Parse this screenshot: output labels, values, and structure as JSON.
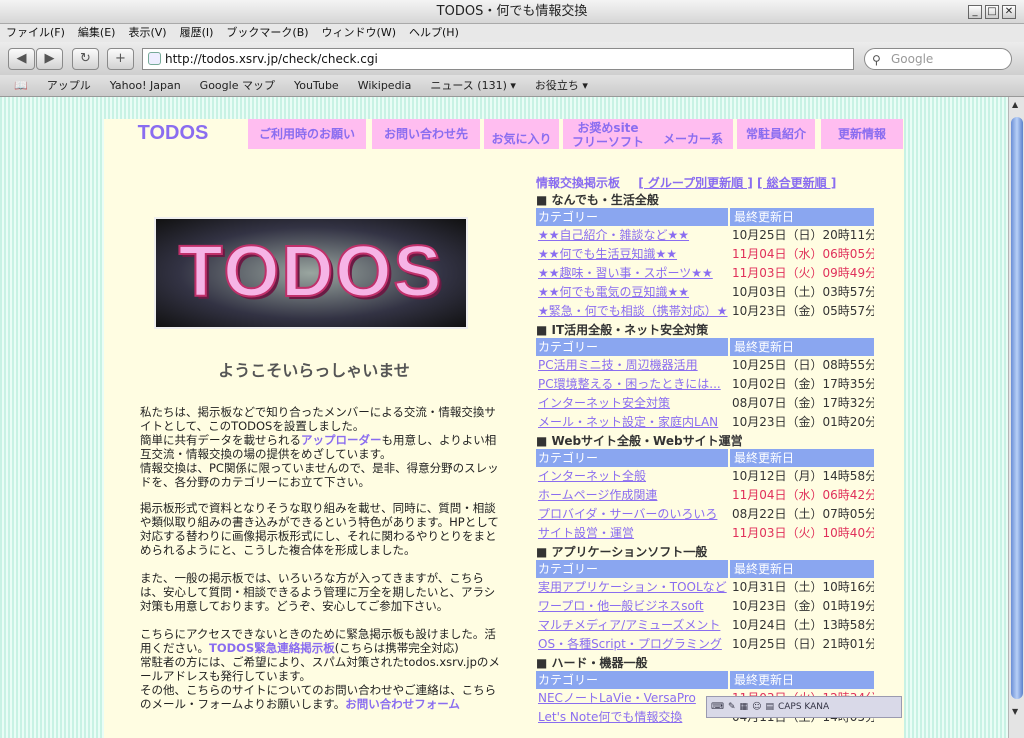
{
  "window": {
    "title": "TODOS・何でも情報交換"
  },
  "menu": [
    "ファイル(F)",
    "編集(E)",
    "表示(V)",
    "履歴(I)",
    "ブックマーク(B)",
    "ウィンドウ(W)",
    "ヘルプ(H)"
  ],
  "toolbar": {
    "url": "http://todos.xsrv.jp/check/check.cgi",
    "search_placeholder": "Google"
  },
  "bookmarks": [
    "アップル",
    "Yahoo! Japan",
    "Google マップ",
    "YouTube",
    "Wikipedia",
    "ニュース (131) ▾",
    "お役立ち ▾"
  ],
  "nav": {
    "logo": "TODOS",
    "tabs": [
      "ご利用時のお願い",
      "お問い合わせ先",
      "お気に入り",
      "お奨めsite",
      "フリーソフト",
      "メーカー系",
      "常駐員紹介",
      "更新情報"
    ]
  },
  "banner_text": "TODOS",
  "welcome": "ようこそいらっしゃいませ",
  "intro": {
    "p1a": "私たちは、掲示板などで知り合ったメンバーによる交流・情報交換サイトとして、このTODOSを設置しました。",
    "p1b": "簡単に共有データを載せられる",
    "p1link": "アップローダー",
    "p1c": "も用意し、よりよい相互交流・情報交換の場の提供をめざしています。",
    "p1d": "情報交換は、PC関係に限っていませんので、是非、得意分野のスレッドを、各分野のカテゴリーにお立て下さい。",
    "p2": "掲示板形式で資料となりそうな取り組みを載せ、同時に、質問・相談や類似取り組みの書き込みができるという特色があります。HPとして対応する替わりに画像掲示板形式にし、それに関わるやりとりをまとめられるようにと、こうした複合体を形成しました。",
    "p3": "また、一般の掲示板では、いろいろな方が入ってきますが、こちらは、安心して質問・相談できるよう管理に万全を期したいと、アラシ対策も用意しております。どうぞ、安心してご参加下さい。",
    "p4a": "こちらにアクセスできないときのために緊急掲示板も設けました。活用ください。",
    "p4link": "TODOS緊急連絡掲示板",
    "p4b": "(こちらは携帯完全対応)",
    "p4c": "常駐者の方には、ご希望により、スパム対策されたtodos.xsrv.jpのメールアドレスも発行しています。",
    "p4d": "その他、こちらのサイトについてのお問い合わせやご連絡は、こちらのメール・フォームよりお願いします。",
    "p4link2": "お問い合わせフォーム"
  },
  "board": {
    "title": "情報交換掲示板",
    "link1": "[ グループ別更新順 ]",
    "link2": "[ 総合更新順 ]",
    "col_category": "カテゴリー",
    "col_updated": "最終更新日",
    "sections": [
      {
        "name": "■ なんでも・生活全般",
        "rows": [
          {
            "cat": "★★自己紹介・雑談など★★",
            "date": "10月25日（日）20時11分",
            "new": false
          },
          {
            "cat": "★★何でも生活豆知識★★",
            "date": "11月04日（水）06時05分",
            "new": true
          },
          {
            "cat": "★★趣味・習い事・スポーツ★★",
            "date": "11月03日（火）09時49分",
            "new": true
          },
          {
            "cat": "★★何でも電気の豆知識★★",
            "date": "10月03日（土）03時57分",
            "new": false
          },
          {
            "cat": "★緊急・何でも相談（携帯対応）★",
            "date": "10月23日（金）05時57分",
            "new": false
          }
        ]
      },
      {
        "name": "■ IT活用全般・ネット安全対策",
        "rows": [
          {
            "cat": "PC活用ミニ技・周辺機器活用",
            "date": "10月25日（日）08時55分",
            "new": false
          },
          {
            "cat": "PC環境整える・困ったときには...",
            "date": "10月02日（金）17時35分",
            "new": false
          },
          {
            "cat": "インターネット安全対策",
            "date": "08月07日（金）17時32分",
            "new": false
          },
          {
            "cat": "メール・ネット設定・家庭内LAN",
            "date": "10月23日（金）01時20分",
            "new": false
          }
        ]
      },
      {
        "name": "■ Webサイト全般・Webサイト運営",
        "rows": [
          {
            "cat": "インターネット全般",
            "date": "10月12日（月）14時58分",
            "new": false
          },
          {
            "cat": "ホームページ作成関連",
            "date": "11月04日（水）06時42分",
            "new": true
          },
          {
            "cat": "プロバイダ・サーバーのいろいろ",
            "date": "08月22日（土）07時05分",
            "new": false
          },
          {
            "cat": "サイト設営・運営",
            "date": "11月03日（火）10時40分",
            "new": true
          }
        ]
      },
      {
        "name": "■ アプリケーションソフト一般",
        "rows": [
          {
            "cat": "実用アプリケーション・TOOLなど",
            "date": "10月31日（土）10時16分",
            "new": false
          },
          {
            "cat": "ワープロ・他一般ビジネスsoft",
            "date": "10月23日（金）01時19分",
            "new": false
          },
          {
            "cat": "マルチメディア/アミューズメント",
            "date": "10月24日（土）13時58分",
            "new": false
          },
          {
            "cat": "OS・各種Script・プログラミング",
            "date": "10月25日（日）21時01分",
            "new": false
          }
        ]
      },
      {
        "name": "■ ハード・機器一般",
        "rows": [
          {
            "cat": "NECノートLaVie・VersaPro",
            "date": "11月03日（火）12時34分",
            "new": true
          },
          {
            "cat": "Let's Note何でも情報交換",
            "date": "04月11日（土）14時05分",
            "new": false
          }
        ]
      }
    ]
  },
  "ime": {
    "label": "CAPS KANA"
  }
}
